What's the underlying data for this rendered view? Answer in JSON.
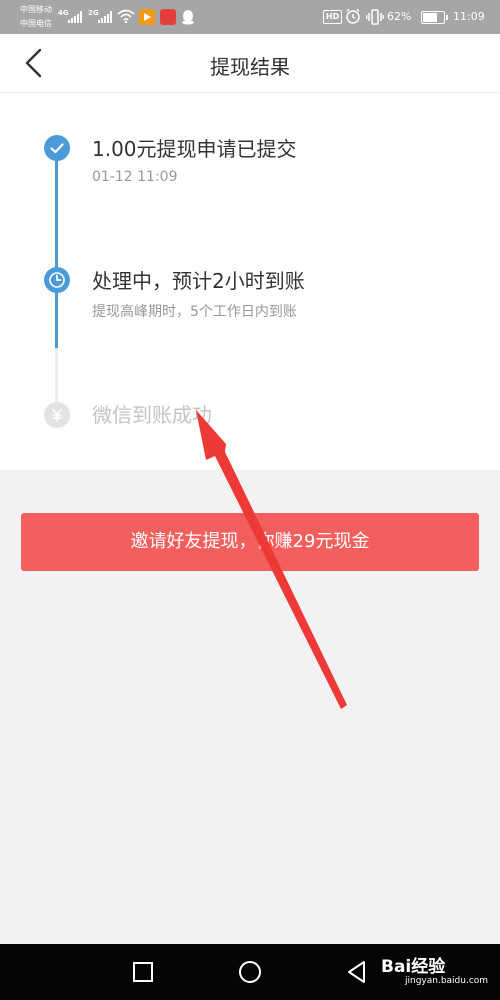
{
  "status_bar": {
    "carrier_1": "中国移动",
    "carrier_2": "中国电信",
    "network_1": "4G",
    "network_2": "2G",
    "hd_label": "HD",
    "battery_percent": "62%",
    "battery_level": 0.62,
    "time": "11:09",
    "icons": [
      "signal-icon",
      "wifi-icon",
      "video-app-icon",
      "shop-app-icon",
      "qq-icon",
      "alarm-icon",
      "vibrate-icon",
      "battery-icon"
    ]
  },
  "header": {
    "title": "提现结果",
    "back_icon": "chevron-left-icon"
  },
  "timeline": {
    "steps": [
      {
        "title": "1.00元提现申请已提交",
        "subtitle": "01-12 11:09",
        "status": "done",
        "icon": "check-icon"
      },
      {
        "title": "处理中，预计2小时到账",
        "subtitle": "提现高峰期时，5个工作日内到账",
        "status": "active",
        "icon": "clock-icon"
      },
      {
        "title": "微信到账成功",
        "subtitle": "",
        "status": "pending",
        "icon": "yen-icon"
      }
    ]
  },
  "invite": {
    "label": "邀请好友提现，你赚29元现金"
  },
  "nav_bar": {
    "icons": [
      "recent-apps-icon",
      "home-icon",
      "back-icon"
    ],
    "watermark_logo": "Bai经验",
    "watermark_url": "jingyan.baidu.com"
  },
  "colors": {
    "accent_blue": "#4a9bd8",
    "button_red": "#f25f5c",
    "arrow_red": "#ee3a36",
    "status_bar": "#a6a6a6"
  }
}
